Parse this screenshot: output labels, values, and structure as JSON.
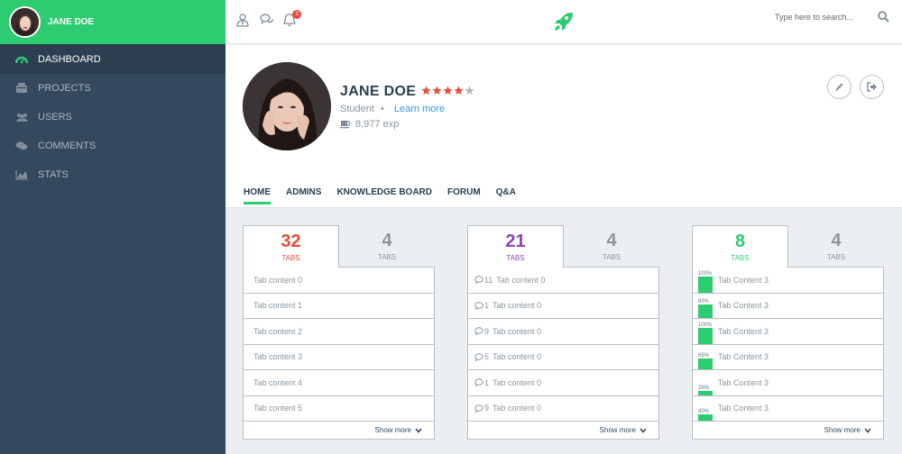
{
  "user": {
    "name": "JANE DOE"
  },
  "sidebar": {
    "items": [
      {
        "label": "DASHBOARD",
        "icon": "dashboard-icon",
        "active": true
      },
      {
        "label": "PROJECTS",
        "icon": "projects-icon"
      },
      {
        "label": "USERS",
        "icon": "users-icon"
      },
      {
        "label": "COMMENTS",
        "icon": "comments-icon"
      },
      {
        "label": "STATS",
        "icon": "stats-icon"
      }
    ]
  },
  "topbar": {
    "notification_count": "3",
    "search_placeholder": "Type here to search..."
  },
  "profile": {
    "name": "JANE DOE",
    "rating": 4,
    "rating_max": 5,
    "role": "Student",
    "separator": "•",
    "learn_more": "Learn more",
    "exp": "8,977 exp"
  },
  "tabs": [
    "HOME",
    "ADMINS",
    "KNOWLEDGE BOARD",
    "FORUM",
    "Q&A"
  ],
  "cards": [
    {
      "active_value": "32",
      "active_label": "TABS",
      "active_color": "#e74c3c",
      "other_value": "4",
      "other_label": "TABS",
      "rows": [
        "Tab content 0",
        "Tab content 1",
        "Tab content 2",
        "Tab content 3",
        "Tab content 4",
        "Tab content 5"
      ],
      "footer": "Show more"
    },
    {
      "active_value": "21",
      "active_label": "TABS",
      "active_color": "#8e44ad",
      "other_value": "4",
      "other_label": "TABS",
      "rows": [
        {
          "count": "11",
          "text": "Tab content 0"
        },
        {
          "count": "1",
          "text": "Tab content 0"
        },
        {
          "count": "9",
          "text": "Tab content 0"
        },
        {
          "count": "5",
          "text": "Tab content 0"
        },
        {
          "count": "1",
          "text": "Tab content 0"
        },
        {
          "count": "9",
          "text": "Tab content 0"
        }
      ],
      "footer": "Show more"
    },
    {
      "active_value": "8",
      "active_label": "TABS",
      "active_color": "#2ecc71",
      "other_value": "4",
      "other_label": "TABS",
      "rows": [
        {
          "percent": "100%",
          "text": "Tab Content 3",
          "value": 1.0
        },
        {
          "percent": "83%",
          "text": "Tab Content 3",
          "value": 0.83
        },
        {
          "percent": "100%",
          "text": "Tab Content 3",
          "value": 1.0
        },
        {
          "percent": "65%",
          "text": "Tab Content 3",
          "value": 0.65
        },
        {
          "percent": "26%",
          "text": "Tab Content 3",
          "value": 0.26
        },
        {
          "percent": "40%",
          "text": "Tab Content 3",
          "value": 0.4
        }
      ],
      "footer": "Show more"
    }
  ],
  "colors": {
    "accent": "#2ecc71",
    "sidebar": "#34495e",
    "danger": "#e74c3c",
    "link": "#3498db"
  }
}
